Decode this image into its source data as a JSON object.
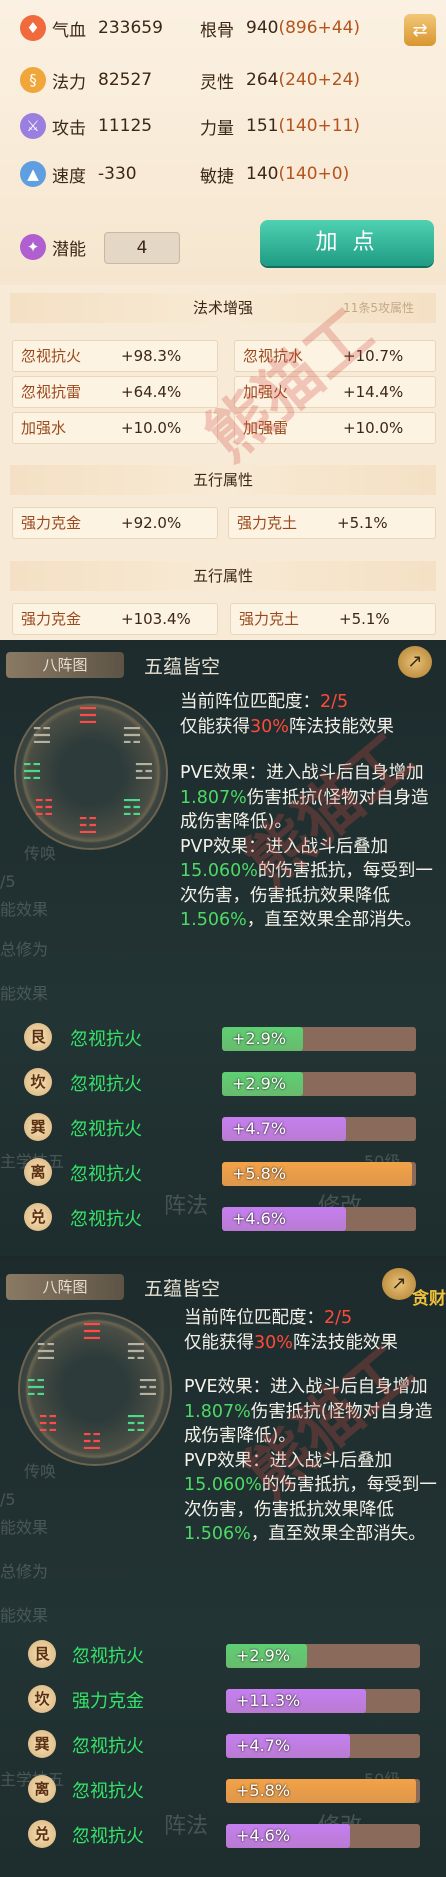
{
  "stats": {
    "hp": {
      "label": "气血",
      "value": "233659",
      "icon": "blood-drop-icon"
    },
    "mana": {
      "label": "法力",
      "value": "82527",
      "icon": "swirl-icon"
    },
    "attack": {
      "label": "攻击",
      "value": "11125",
      "icon": "sword-icon"
    },
    "speed": {
      "label": "速度",
      "value": "-330",
      "icon": "boot-icon"
    },
    "potential": {
      "label": "潜能",
      "value": "4",
      "icon": "flame-icon"
    },
    "root": {
      "label": "根骨",
      "value": "940",
      "bonus": "(896+44)"
    },
    "spirit": {
      "label": "灵性",
      "value": "264",
      "bonus": "(240+24)"
    },
    "strength": {
      "label": "力量",
      "value": "151",
      "bonus": "(140+11)"
    },
    "agility": {
      "label": "敏捷",
      "value": "140",
      "bonus": "(140+0)"
    }
  },
  "buttons": {
    "add_points": "加 点",
    "refresh_icon": "swap-icon"
  },
  "sections": [
    {
      "title": "法术增强",
      "hint": "11条5攻属性",
      "items": [
        {
          "name": "忽视抗火",
          "value": "+98.3%"
        },
        {
          "name": "忽视抗水",
          "value": "+10.7%"
        },
        {
          "name": "忽视抗雷",
          "value": "+64.4%"
        },
        {
          "name": "加强火",
          "value": "+14.4%"
        },
        {
          "name": "加强水",
          "value": "+10.0%"
        },
        {
          "name": "加强雷",
          "value": "+10.0%"
        }
      ]
    },
    {
      "title": "五行属性",
      "items": [
        {
          "name": "强力克金",
          "value": "+92.0%"
        },
        {
          "name": "强力克土",
          "value": "+5.1%"
        }
      ]
    },
    {
      "title": "五行属性",
      "items": [
        {
          "name": "强力克金",
          "value": "+103.4%"
        },
        {
          "name": "强力克土",
          "value": "+5.1%"
        }
      ]
    }
  ],
  "watermark": "熊猫工",
  "formations": [
    {
      "tab": "八阵图",
      "name": "五蕴皆空",
      "match_label": "当前阵位匹配度：",
      "match_value": "2/5",
      "only_get": "仅能获得",
      "only_pct": "30%",
      "only_tail": "阵法技能效果",
      "pve_head": "PVE效果：进入战斗后自身增加",
      "pve_val": "1.807%",
      "pve_tail": "伤害抵抗(怪物对自身造成伤害降低)。",
      "pvp_head": "PVP效果：进入战斗后叠加",
      "pvp_val": "15.060%",
      "pvp_mid": "的伤害抵抗，每受到一次伤害，伤害抵抗效果降低",
      "pvp_val2": "1.506%",
      "pvp_tail": "，直至效果全部消失。",
      "ghost_texts": [
        "传唤",
        "/5",
        "能效果",
        "总修为",
        "能效果",
        "主学技五",
        "50级",
        "阵法",
        "修改"
      ],
      "effects": [
        {
          "badge": "艮",
          "name": "忽视抗火",
          "value": "+2.9%",
          "fill": 0.42,
          "color": "#5fcf73"
        },
        {
          "badge": "坎",
          "name": "忽视抗火",
          "value": "+2.9%",
          "fill": 0.42,
          "color": "#5fcf73"
        },
        {
          "badge": "巽",
          "name": "忽视抗火",
          "value": "+4.7%",
          "fill": 0.64,
          "color": "#c57ff0"
        },
        {
          "badge": "离",
          "name": "忽视抗火",
          "value": "+5.8%",
          "fill": 0.98,
          "color": "#f3a247"
        },
        {
          "badge": "兑",
          "name": "忽视抗火",
          "value": "+4.6%",
          "fill": 0.64,
          "color": "#c57ff0"
        }
      ]
    },
    {
      "tab": "八阵图",
      "name": "五蕴皆空",
      "extra": "贪财",
      "match_label": "当前阵位匹配度：",
      "match_value": "2/5",
      "only_get": "仅能获得",
      "only_pct": "30%",
      "only_tail": "阵法技能效果",
      "pve_head": "PVE效果：进入战斗后自身增加",
      "pve_val": "1.807%",
      "pve_tail": "伤害抵抗(怪物对自身造成伤害降低)。",
      "pvp_head": "PVP效果：进入战斗后叠加",
      "pvp_val": "15.060%",
      "pvp_mid": "的伤害抵抗，每受到一次伤害，伤害抵抗效果降低",
      "pvp_val2": "1.506%",
      "pvp_tail": "，直至效果全部消失。",
      "ghost_texts": [
        "传唤",
        "/5",
        "能效果",
        "总修为",
        "能效果",
        "主学技五",
        "50级",
        "阵法",
        "修改"
      ],
      "effects": [
        {
          "badge": "艮",
          "name": "忽视抗火",
          "value": "+2.9%",
          "fill": 0.42,
          "color": "#5fcf73"
        },
        {
          "badge": "坎",
          "name": "强力克金",
          "value": "+11.3%",
          "fill": 0.72,
          "color": "#c57ff0"
        },
        {
          "badge": "巽",
          "name": "忽视抗火",
          "value": "+4.7%",
          "fill": 0.64,
          "color": "#c57ff0"
        },
        {
          "badge": "离",
          "name": "忽视抗火",
          "value": "+5.8%",
          "fill": 0.98,
          "color": "#f3a247"
        },
        {
          "badge": "兑",
          "name": "忽视抗火",
          "value": "+4.6%",
          "fill": 0.64,
          "color": "#c57ff0"
        }
      ]
    }
  ]
}
